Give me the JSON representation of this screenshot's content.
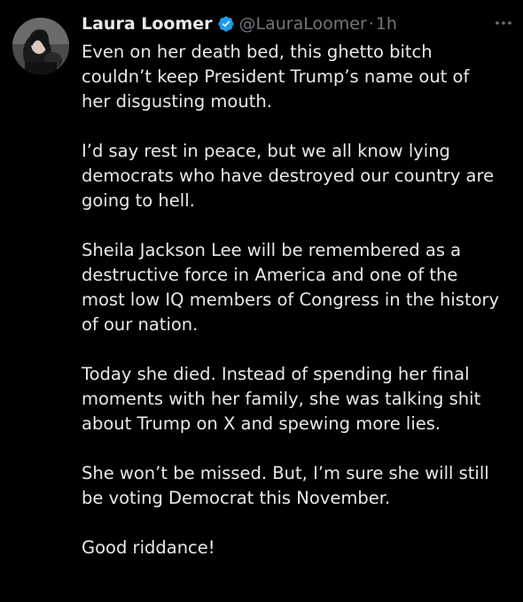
{
  "tweet": {
    "author": {
      "name": "Laura Loomer",
      "handle": "@LauraLoomer",
      "verified_icon": "verified-badge-icon",
      "avatar_icon": "avatar"
    },
    "separator": "·",
    "time": "1h",
    "more_icon": "more-options-icon",
    "paragraphs": [
      "Even on her death bed, this ghetto bitch\ncouldn’t keep President Trump’s name out of\nher disgusting mouth.",
      "I’d say rest in peace, but we all know lying\ndemocrats who have destroyed our country are\ngoing to hell.",
      "Sheila Jackson Lee will be remembered as a\ndestructive force in America and one of the\nmost low IQ members of Congress in the history\nof our nation.",
      "Today she died. Instead of spending her final\nmoments with her family, she was talking shit\nabout Trump on X and spewing more lies.",
      "She won’t be missed. But, I’m sure she will still\nbe voting Democrat this November.",
      "Good riddance!"
    ]
  },
  "colors": {
    "background": "#000000",
    "text": "#e7e9ea",
    "secondary": "#71767b",
    "verified": "#1d9bf0"
  }
}
